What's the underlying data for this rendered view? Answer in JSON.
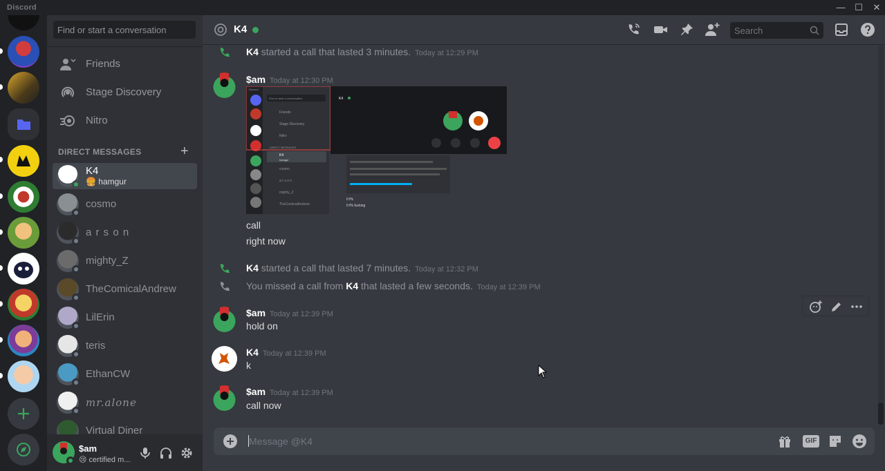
{
  "app": {
    "brand": "Discord"
  },
  "window": {
    "minimize": "—",
    "maximize": "☐",
    "close": "✕"
  },
  "sidebar": {
    "search_placeholder": "Find or start a conversation",
    "nav": [
      {
        "label": "Friends",
        "icon": "friends-icon"
      },
      {
        "label": "Stage Discovery",
        "icon": "stage-icon"
      },
      {
        "label": "Nitro",
        "icon": "nitro-icon"
      }
    ],
    "dm_header": "DIRECT MESSAGES",
    "dms": [
      {
        "name": "K4",
        "sub": "hamgur",
        "online": true,
        "active": true,
        "color": "#ffffff"
      },
      {
        "name": "cosmo",
        "online": false,
        "color": "#8a8f94"
      },
      {
        "name": "a r s o n",
        "online": false,
        "color": "#2b2b2b"
      },
      {
        "name": "mighty_Z",
        "online": false,
        "color": "#6b6b6b"
      },
      {
        "name": "TheComicalAndrew",
        "online": false,
        "color": "#5a4a2a"
      },
      {
        "name": "LilErin",
        "online": false,
        "color": "#b0a8c8"
      },
      {
        "name": "teris",
        "online": false,
        "color": "#e6e6e6"
      },
      {
        "name": "EthanCW",
        "online": false,
        "color": "#4a9ac4"
      },
      {
        "name": "mr.alone",
        "online": false,
        "color": "#f0f0f0"
      },
      {
        "name": "Virtual Diner",
        "online": false,
        "color": "#2f5a2f"
      }
    ],
    "user": {
      "name": "$am",
      "status": "certified m..."
    }
  },
  "header": {
    "title": "K4",
    "search_placeholder": "Search"
  },
  "messages": {
    "sys1": {
      "who": "K4",
      "text": "started a call that lasted 3 minutes.",
      "time": "Today at 12:29 PM"
    },
    "m1": {
      "author": "$am",
      "time": "Today at 12:30 PM",
      "lines": [
        "call",
        "right now"
      ]
    },
    "sys2": {
      "who": "K4",
      "text": "started a call that lasted 7 minutes.",
      "time": "Today at 12:32 PM"
    },
    "sys3": {
      "pre": "You missed a call from",
      "who": "K4",
      "post": "that lasted a few seconds.",
      "time": "Today at 12:39 PM"
    },
    "m2": {
      "author": "$am",
      "time": "Today at 12:39 PM",
      "text": "hold on"
    },
    "m3": {
      "author": "K4",
      "time": "Today at 12:39 PM",
      "text": "k"
    },
    "m4": {
      "author": "$am",
      "time": "Today at 12:39 PM",
      "text": "call now"
    }
  },
  "attachment": {
    "brand": "Discord",
    "search": "Find or start a conversation",
    "nav": [
      "Friends",
      "Stage Discovery",
      "Nitro"
    ],
    "dm_header": "DIRECT MESSAGES",
    "dms": [
      "K4",
      "cosmo",
      "a r s o n",
      "mighty_Z",
      "TheComicalAndrew"
    ],
    "k4_sub": "hamgur",
    "header": "K4",
    "chat_lines": [
      "0 f%",
      "0 f% fucking"
    ]
  },
  "composer": {
    "placeholder": "Message @K4",
    "gif": "GIF"
  },
  "colors": {
    "online": "#3ba55d",
    "accent": "#5865f2",
    "bg": "#36393f"
  }
}
